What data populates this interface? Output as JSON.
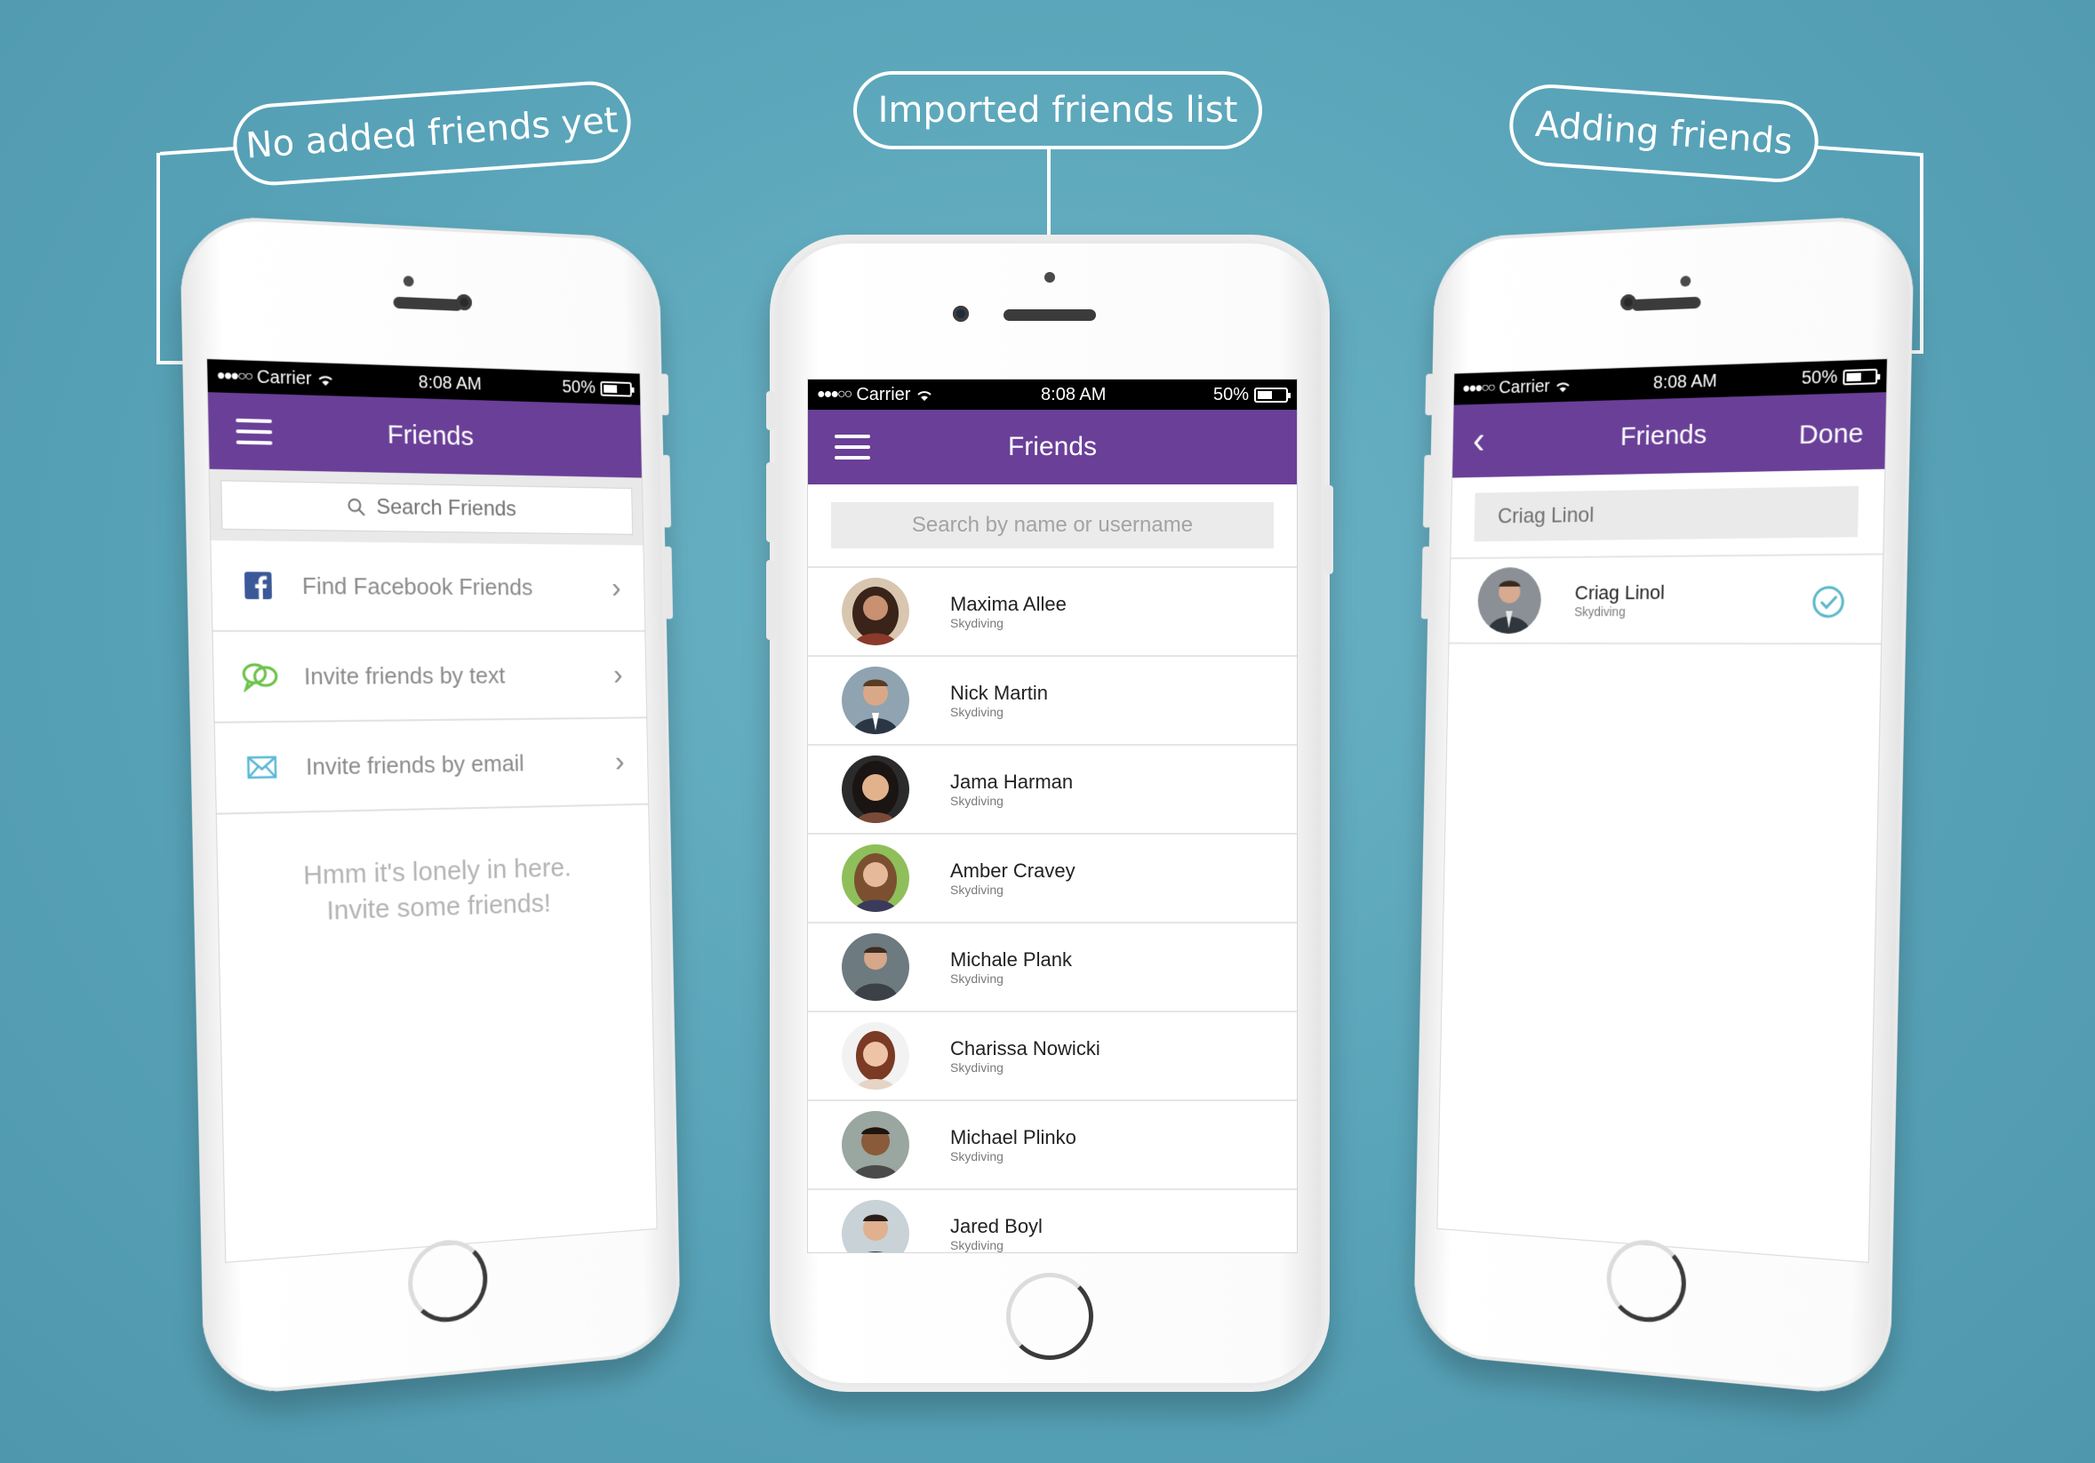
{
  "callouts": {
    "left": "No added friends yet",
    "center": "Imported friends list",
    "right": "Adding friends"
  },
  "status_bar": {
    "carrier": "Carrier",
    "time": "8:08 AM",
    "battery": "50%"
  },
  "screen_left": {
    "title": "Friends",
    "search_placeholder": "Search Friends",
    "options": [
      {
        "label": "Find Facebook Friends",
        "icon": "facebook-icon",
        "color": "#3b5998"
      },
      {
        "label": "Invite friends by text",
        "icon": "chat-bubbles-icon",
        "color": "#6cc24a"
      },
      {
        "label": "Invite friends by email",
        "icon": "envelope-icon",
        "color": "#5ab8d6"
      }
    ],
    "empty_message": [
      "Hmm it's lonely in here.",
      "Invite some friends!"
    ]
  },
  "screen_center": {
    "title": "Friends",
    "search_placeholder": "Search by name or username",
    "friends": [
      {
        "name": "Maxima Allee",
        "activity": "Skydiving"
      },
      {
        "name": "Nick Martin",
        "activity": "Skydiving"
      },
      {
        "name": "Jama Harman",
        "activity": "Skydiving"
      },
      {
        "name": "Amber Cravey",
        "activity": "Skydiving"
      },
      {
        "name": "Michale Plank",
        "activity": "Skydiving"
      },
      {
        "name": "Charissa Nowicki",
        "activity": "Skydiving"
      },
      {
        "name": "Michael Plinko",
        "activity": "Skydiving"
      },
      {
        "name": "Jared Boyl",
        "activity": "Skydiving"
      }
    ]
  },
  "screen_right": {
    "title": "Friends",
    "done_label": "Done",
    "search_value": "Criag Linol",
    "result": {
      "name": "Criag Linol",
      "activity": "Skydiving",
      "selected": true
    }
  },
  "colors": {
    "background": "#5aa6bb",
    "nav_purple": "#6a3f98",
    "check_teal": "#5ab8c9"
  }
}
